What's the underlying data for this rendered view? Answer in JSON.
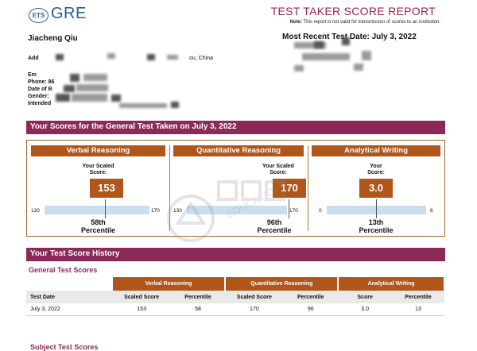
{
  "header": {
    "ets_logo": "ETS",
    "gre_logo": "GRE",
    "report_title": "TEST TAKER SCORE REPORT",
    "note_label": "Note:",
    "note_text": "This report is not valid for transmission of scores to an institution.",
    "recent_test_date": "Most Recent Test Date: July 3, 2022"
  },
  "taker": {
    "name": "Jiacheng Qiu",
    "address_label": "Add",
    "address_tail": "ou, China",
    "email_label": "Em",
    "phone_label": "Phone: 86",
    "dob_label": "Date of B",
    "gender_label": "Gender:",
    "intended_label": "Intended"
  },
  "scores_banner": "Your Scores for the General Test Taken on July 3, 2022",
  "scores": [
    {
      "section": "Verbal Reasoning",
      "label_line1": "Your Scaled",
      "label_line2": "Score:",
      "score": "153",
      "min": "130",
      "max": "170",
      "percentile": "58th",
      "percentile_label": "Percentile",
      "fraction": 0.575
    },
    {
      "section": "Quantitative Reasoning",
      "label_line1": "Your Scaled",
      "label_line2": "Score:",
      "score": "170",
      "min": "130",
      "max": "170",
      "percentile": "96th",
      "percentile_label": "Percentile",
      "fraction": 1.0
    },
    {
      "section": "Analytical Writing",
      "label_line1": "Your",
      "label_line2": "Score:",
      "score": "3.0",
      "min": "0",
      "max": "6",
      "percentile": "13th",
      "percentile_label": "Percentile",
      "fraction": 0.5
    }
  ],
  "history_banner": "Your Test Score History",
  "general_heading": "General Test Scores",
  "table": {
    "groups": [
      "Verbal Reasoning",
      "Quantitative Reasoning",
      "Analytical Writing"
    ],
    "columns": [
      "Test Date",
      "Scaled Score",
      "Percentile",
      "Scaled Score",
      "Percentile",
      "Score",
      "Percentile"
    ],
    "rows": [
      [
        "July 3, 2022",
        "153",
        "58",
        "170",
        "96",
        "3.0",
        "13"
      ]
    ]
  },
  "subject_heading": "Subject Test Scores",
  "watermark_text": "EDUCATION",
  "colors": {
    "banner": "#8b2a59",
    "orange": "#b0561b",
    "bar": "#c9dff0",
    "brand_blue": "#2a5a9a"
  }
}
